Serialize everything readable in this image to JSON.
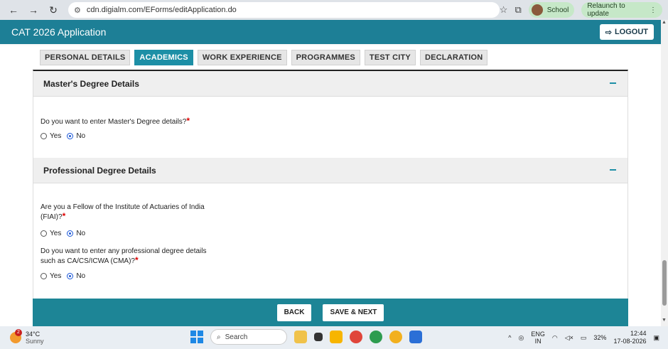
{
  "browser": {
    "url": "cdn.digialm.com/EForms/editApplication.do",
    "profile_label": "School",
    "relaunch_label": "Relaunch to update"
  },
  "app": {
    "title": "CAT 2026 Application",
    "logout_label": "LOGOUT"
  },
  "tabs": [
    {
      "label": "PERSONAL DETAILS",
      "active": false
    },
    {
      "label": "ACADEMICS",
      "active": true
    },
    {
      "label": "WORK EXPERIENCE",
      "active": false
    },
    {
      "label": "PROGRAMMES",
      "active": false
    },
    {
      "label": "TEST CITY",
      "active": false
    },
    {
      "label": "DECLARATION",
      "active": false
    }
  ],
  "masters": {
    "heading": "Master's Degree Details",
    "question": "Do you want to enter Master's Degree details?",
    "yes_label": "Yes",
    "no_label": "No",
    "selected": "No"
  },
  "professional": {
    "heading": "Professional Degree Details",
    "q1_line1": "Are you a Fellow of the Institute of Actuaries of India",
    "q1_line2": "(FIAI)?",
    "q2_line1": "Do you want to enter any professional degree details",
    "q2_line2": "such as CA/CS/ICWA (CMA)?",
    "yes_label": "Yes",
    "no_label": "No",
    "q1_selected": "No",
    "q2_selected": "No"
  },
  "required_mark": "*",
  "actions": {
    "back_label": "BACK",
    "save_next_label": "SAVE & NEXT"
  },
  "taskbar": {
    "temperature": "34°C",
    "weather": "Sunny",
    "weather_badge": "2",
    "search_placeholder": "Search",
    "language": "ENG",
    "region": "IN",
    "battery": "32%",
    "time": "12:44",
    "date": "17-08-2026"
  },
  "colors": {
    "primary": "#1d7f96",
    "active_tab": "#1d8fa6",
    "required": "#dd0000"
  }
}
